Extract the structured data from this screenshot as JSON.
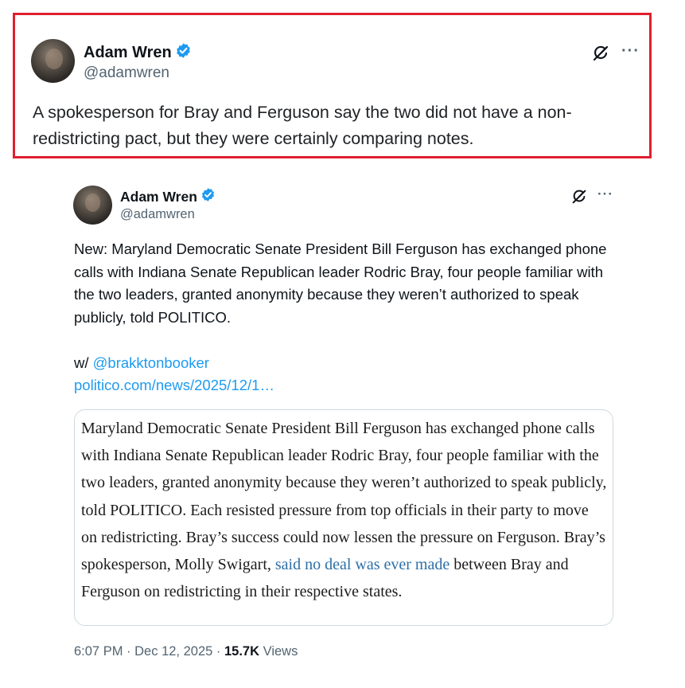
{
  "reply": {
    "author_name": "Adam Wren",
    "handle": "@adamwren",
    "text": "A spokesperson for Bray and Ferguson say the two did not have a non-redistricting pact, but they were certainly comparing notes."
  },
  "post": {
    "author_name": "Adam Wren",
    "handle": "@adamwren",
    "body": "New: Maryland Democratic Senate President Bill Ferguson has exchanged phone calls with Indiana Senate Republican leader Rodric Bray, four people familiar with the two leaders, granted anonymity because they weren’t authorized to speak publicly, told POLITICO.",
    "with_prefix": "w/ ",
    "mention": "@brakktonbooker",
    "link": "politico.com/news/2025/12/1…",
    "quote": {
      "text_before": "Maryland Democratic Senate President Bill Ferguson has exchanged phone calls with Indiana Senate Republican leader Rodric Bray, four people familiar with the two leaders, granted anonymity because they weren’t authorized to speak publicly, told POLITICO. Each resisted pressure from top officials in their party to move on redistricting. Bray’s success could now lessen the pressure on Ferguson. Bray’s spokesperson, Molly Swigart, ",
      "link_text": "said no deal was ever made",
      "text_after": " between Bray and Ferguson on redistricting in their respective states."
    },
    "time": "6:07 PM",
    "separator": "·",
    "date": "Dec 12, 2025",
    "views_count": "15.7K",
    "views_label": "Views"
  },
  "icons": {
    "verified": "verified-badge-icon",
    "grok": "grok-icon",
    "more": "more-options-icon"
  },
  "colors": {
    "highlight_border": "#e0202e",
    "link": "#1d9bf0",
    "verified": "#1d9bf0",
    "secondary_text": "#536471"
  }
}
